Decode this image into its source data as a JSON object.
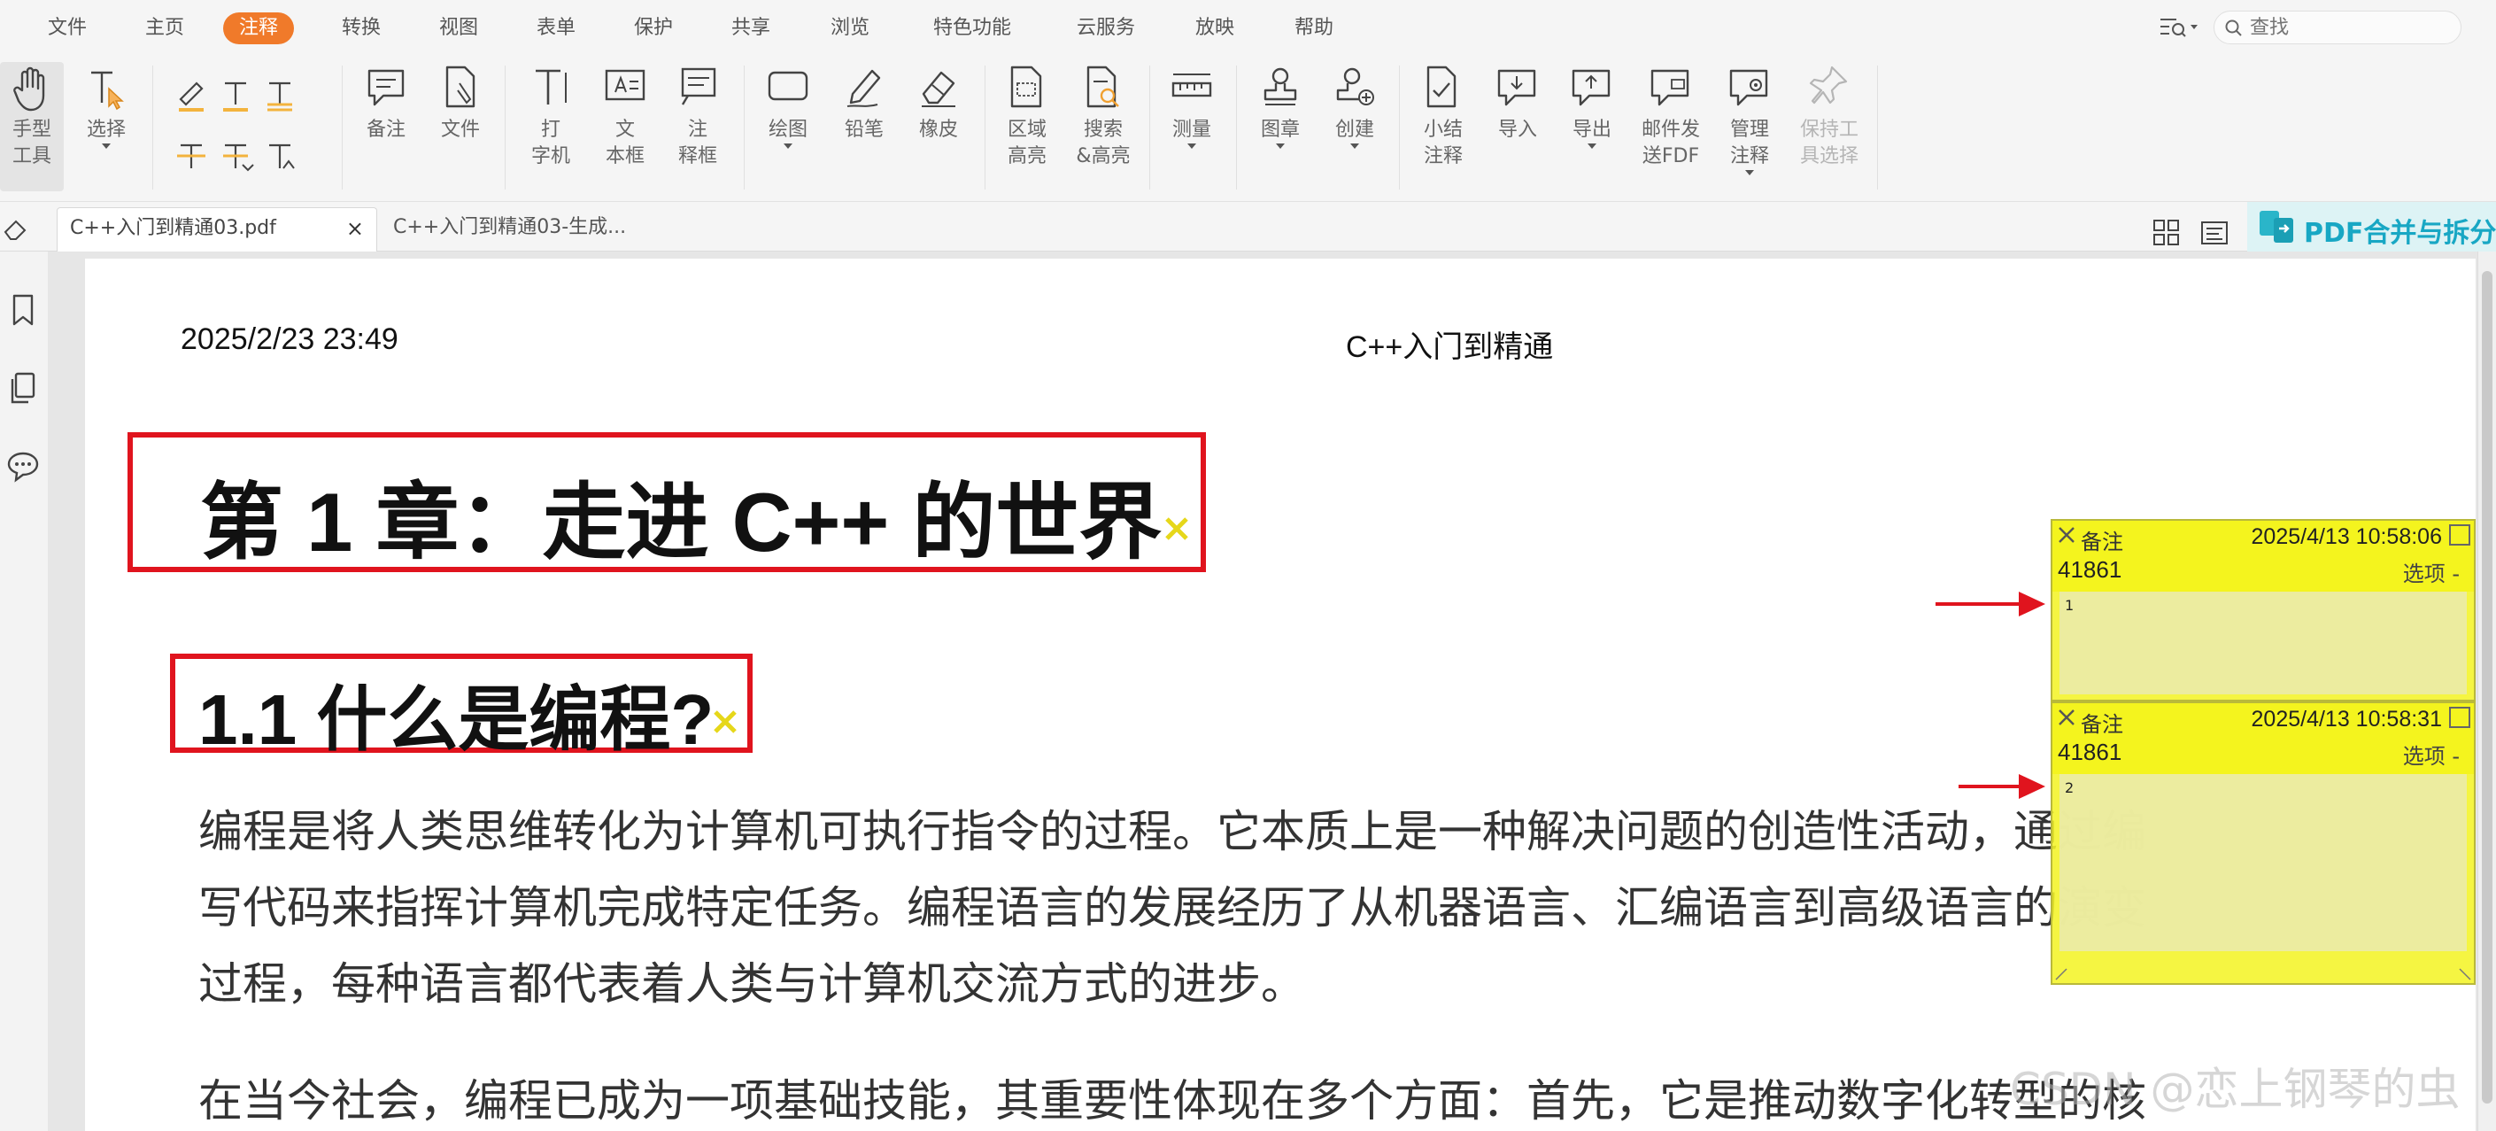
{
  "menu": {
    "items": [
      "文件",
      "主页",
      "注释",
      "转换",
      "视图",
      "表单",
      "保护",
      "共享",
      "浏览",
      "特色功能",
      "云服务",
      "放映",
      "帮助"
    ],
    "active_index": 2
  },
  "search": {
    "placeholder": "查找"
  },
  "ribbon": {
    "hand": "手型\n工具",
    "select": "选择",
    "note": "备注",
    "file": "文件",
    "typewriter": "打\n字机",
    "textbox": "文\n本框",
    "callout": "注\n释框",
    "draw": "绘图",
    "pencil": "铅笔",
    "eraser": "橡皮",
    "area_highlight": "区域\n高亮",
    "search_highlight": "搜索\n&高亮",
    "measure": "测量",
    "stamp": "图章",
    "create": "创建",
    "summary": "小结\n注释",
    "import": "导入",
    "export": "导出",
    "mail_fdf": "邮件发\n送FDF",
    "manage": "管理\n注释",
    "keep_tool": "保持工\n具选择"
  },
  "tabs": {
    "tab1": "C++入门到精通03.pdf",
    "tab2": "C++入门到精通03-生成...",
    "close": "×"
  },
  "promo": {
    "text": "PDF合并与拆分"
  },
  "page": {
    "date": "2025/2/23 23:49",
    "running_title": "C++入门到精通",
    "heading1": "第 1 章：走进 C++ 的世界",
    "heading2": "1.1 什么是编程?",
    "paragraph1": [
      "编程是将人类思维转化为计算机可执行指令的过程。它本质上是一种解决问题的创造性活动，通过编",
      "写代码来指挥计算机完成特定任务。编程语言的发展经历了从机器语言、汇编语言到高级语言的演变",
      "过程，每种语言都代表着人类与计算机交流方式的进步。"
    ],
    "paragraph2": [
      "在当今社会，编程已成为一项基础技能，其重要性体现在多个方面：首先，它是推动数字化转型的核"
    ]
  },
  "notes": [
    {
      "type": "备注",
      "date": "2025/4/13 10:58:06",
      "author": "41861",
      "options": "选项 -",
      "body": "1"
    },
    {
      "type": "备注",
      "date": "2025/4/13 10:58:31",
      "author": "41861",
      "options": "选项 -",
      "body": "2"
    }
  ],
  "watermark": "CSDN @恋上钢琴的虫",
  "colors": {
    "accent": "#f07a2a",
    "annotation_red": "#e0141e",
    "note_yellow": "#f4f41e",
    "promo": "#18a7c4"
  }
}
